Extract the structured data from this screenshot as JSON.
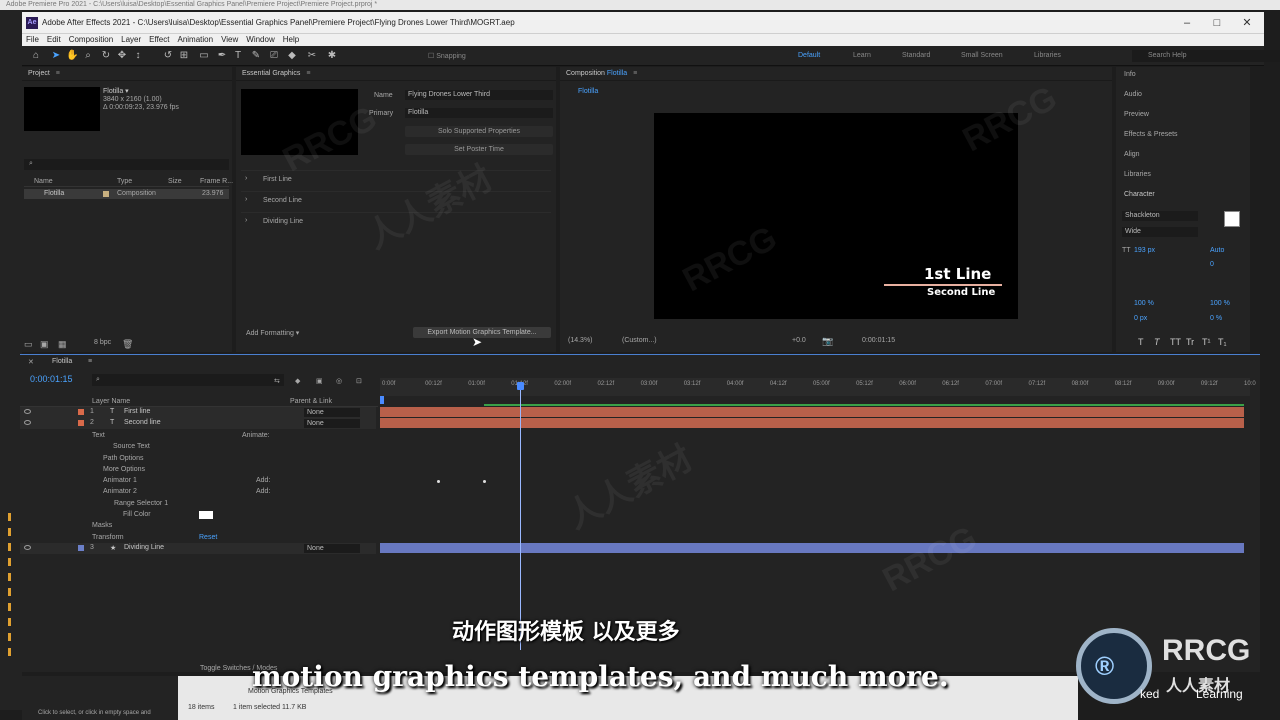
{
  "premiere": {
    "title": "Adobe Premiere Pro 2021 - C:\\Users\\luisa\\Desktop\\Essential Graphics Panel\\Premiere Project\\Premiere Project.prproj *"
  },
  "ae": {
    "title": "Adobe After Effects 2021 - C:\\Users\\luisa\\Desktop\\Essential Graphics Panel\\Premiere Project\\Flying Drones Lower Third\\MOGRT.aep",
    "menu": [
      "File",
      "Edit",
      "Composition",
      "Layer",
      "Effect",
      "Animation",
      "View",
      "Window",
      "Help"
    ],
    "toolbar": {
      "snapping": "Snapping",
      "workspaces": [
        "Default",
        "Learn",
        "Standard",
        "Small Screen",
        "Libraries"
      ],
      "search": "Search Help"
    }
  },
  "project": {
    "title": "Project",
    "comp_name": "Flotilla",
    "comp_info": [
      "3840 x 2160 (1.00)",
      "Δ 0:00:09:23, 23.976 fps"
    ],
    "cols": [
      "Name",
      "Type",
      "Size",
      "Frame R..."
    ],
    "row": {
      "name": "Flotilla",
      "type": "Composition",
      "fps": "23.976"
    },
    "bpc": "8 bpc"
  },
  "eg": {
    "title": "Essential Graphics",
    "name_label": "Name",
    "name_value": "Flying Drones Lower Third",
    "primary_label": "Primary",
    "primary_value": "Flotilla",
    "solo_btn": "Solo Supported Properties",
    "poster_btn": "Set Poster Time",
    "items": [
      "First Line",
      "Second Line",
      "Dividing Line"
    ],
    "add_formatting": "Add Formatting",
    "export_btn": "Export Motion Graphics Template..."
  },
  "comp": {
    "panel_title": "Composition",
    "name": "Flotilla",
    "tab": "Flotilla",
    "line1": "1st Line",
    "line2": "Second Line",
    "zoom": "(14.3%)",
    "res": "(Custom...)",
    "exposure": "+0.0",
    "time": "0:00:01:15"
  },
  "right": {
    "panels": [
      "Info",
      "Audio",
      "Preview",
      "Effects & Presets",
      "Align",
      "Libraries"
    ],
    "character": "Character",
    "font": "Shackleton",
    "style": "Wide",
    "size": "193 px",
    "leading": "Auto",
    "tracking": "0",
    "scale_v": "100 %",
    "scale_h": "100 %",
    "baseline": "0 px",
    "tsume": "0 %",
    "text_buttons": [
      "T",
      "T",
      "TT",
      "Tr",
      "T¹",
      "T₁"
    ]
  },
  "timeline": {
    "comp_tab": "Flotilla",
    "timecode": "0:00:01:15",
    "cols": {
      "layer_name": "Layer Name",
      "parent": "Parent & Link"
    },
    "ticks": [
      "0:00f",
      "00:12f",
      "01:00f",
      "01:12f",
      "02:00f",
      "02:12f",
      "03:00f",
      "03:12f",
      "04:00f",
      "04:12f",
      "05:00f",
      "05:12f",
      "06:00f",
      "06:12f",
      "07:00f",
      "07:12f",
      "08:00f",
      "08:12f",
      "09:00f",
      "09:12f",
      "10:0"
    ],
    "layers": [
      {
        "num": "1",
        "name": "First line",
        "parent": "None",
        "color": "#d96a4a"
      },
      {
        "num": "2",
        "name": "Second line",
        "parent": "None",
        "color": "#d96a4a"
      }
    ],
    "props": {
      "text": "Text",
      "animate": "Animate:",
      "source_text": "Source Text",
      "path_options": "Path Options",
      "more_options": "More Options",
      "animator1": "Animator 1",
      "animator2": "Animator 2",
      "add": "Add:",
      "range_selector": "Range Selector 1",
      "fill_color": "Fill Color",
      "masks": "Masks",
      "transform": "Transform",
      "reset": "Reset"
    },
    "layer3": {
      "num": "3",
      "name": "Dividing Line",
      "parent": "None",
      "color": "#6b7fc8"
    },
    "toggle": "Toggle Switches / Modes"
  },
  "explorer": {
    "items": "18 items",
    "selected": "1 item selected  11.7 KB",
    "status": "Click to select, or click in empty space and",
    "folder": "Motion Graphics Templates"
  },
  "subtitle": {
    "cn": "动作图形模板 以及更多",
    "en": "motion graphics templates, and much more."
  },
  "watermark": {
    "brand": "RRCG",
    "cn": "人人素材",
    "learning": "Learning",
    "ked": "ked"
  },
  "colors": {
    "accent": "#4aa3ff",
    "orange_bar": "#b8604a",
    "blue_bar": "#6878c0"
  }
}
